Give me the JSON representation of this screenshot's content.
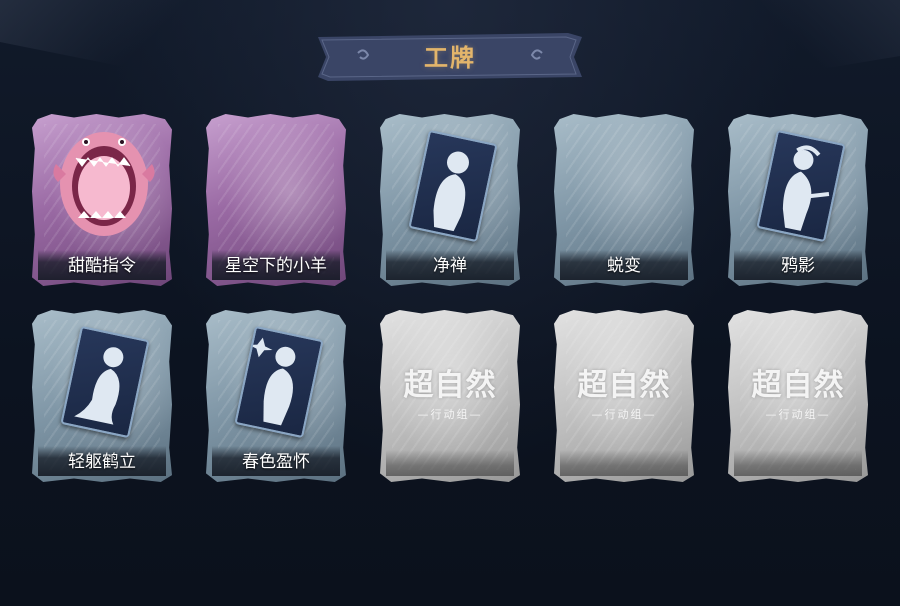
{
  "header": {
    "title": "工牌"
  },
  "placeholder": {
    "logo_main": "超自然",
    "logo_sub": "—行动组—"
  },
  "cards": [
    {
      "label": "甜酷指令",
      "style": "purple",
      "art": "shark-icon"
    },
    {
      "label": "星空下的小羊",
      "style": "purple",
      "art": "none"
    },
    {
      "label": "净禅",
      "style": "blue",
      "art": "silhouette-icon"
    },
    {
      "label": "蜕变",
      "style": "blue",
      "art": "none"
    },
    {
      "label": "鸦影",
      "style": "blue",
      "art": "silhouette-icon"
    },
    {
      "label": "轻躯鹤立",
      "style": "blue",
      "art": "silhouette-icon"
    },
    {
      "label": "春色盈怀",
      "style": "blue",
      "art": "silhouette-icon"
    },
    {
      "label": "",
      "style": "grey",
      "art": "placeholder-logo"
    },
    {
      "label": "",
      "style": "grey",
      "art": "placeholder-logo"
    },
    {
      "label": "",
      "style": "grey",
      "art": "placeholder-logo"
    }
  ],
  "colors": {
    "background": "#0d1421",
    "title_gold": "#e3b56b",
    "banner": "#3a4566",
    "card_purple": "#a578ad",
    "card_blue": "#8298a8",
    "card_grey": "#c4c4c4"
  }
}
